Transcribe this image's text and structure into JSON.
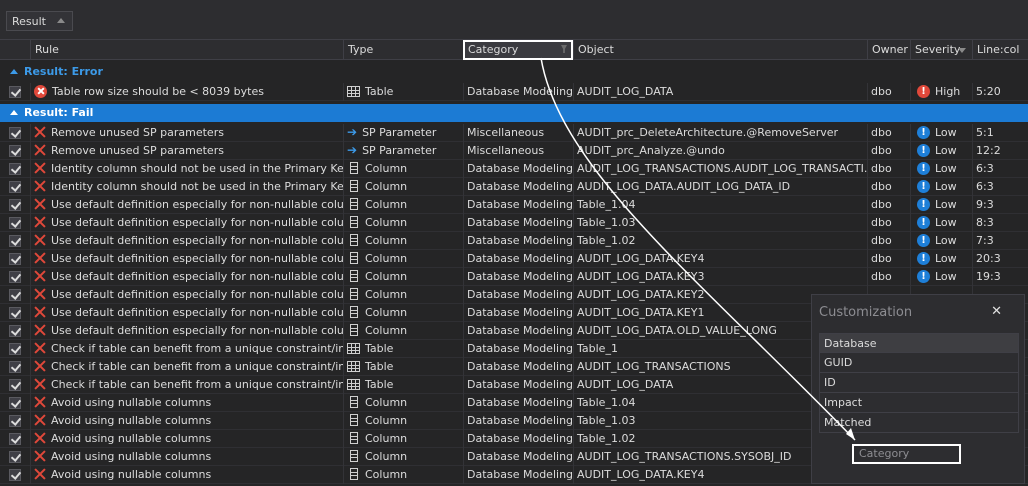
{
  "toolbar": {
    "group_label": "Result"
  },
  "columns": {
    "rule": "Rule",
    "type": "Type",
    "category": "Category",
    "object": "Object",
    "owner": "Owner",
    "severity": "Severity",
    "linecol": "Line:col"
  },
  "groups": {
    "error": "Result: Error",
    "fail": "Result: Fail"
  },
  "error_rows": [
    {
      "rule": "Table row size should be < 8039 bytes",
      "type": "Table",
      "category": "Database Modeling",
      "object": "AUDIT_LOG_DATA",
      "owner": "dbo",
      "severity": "High",
      "linecol": "5:20"
    }
  ],
  "fail_rows": [
    {
      "rule": "Remove unused SP parameters",
      "type": "SP Parameter",
      "category": "Miscellaneous",
      "object": "AUDIT_prc_DeleteArchitecture.@RemoveServer",
      "owner": "dbo",
      "severity": "Low",
      "linecol": "5:1"
    },
    {
      "rule": "Remove unused SP parameters",
      "type": "SP Parameter",
      "category": "Miscellaneous",
      "object": "AUDIT_prc_Analyze.@undo",
      "owner": "dbo",
      "severity": "Low",
      "linecol": "12:2"
    },
    {
      "rule": "Identity column should not be used in the Primary Key",
      "type": "Column",
      "category": "Database Modeling",
      "object": "AUDIT_LOG_TRANSACTIONS.AUDIT_LOG_TRANSACTI...",
      "owner": "dbo",
      "severity": "Low",
      "linecol": "6:3"
    },
    {
      "rule": "Identity column should not be used in the Primary Key",
      "type": "Column",
      "category": "Database Modeling",
      "object": "AUDIT_LOG_DATA.AUDIT_LOG_DATA_ID",
      "owner": "dbo",
      "severity": "Low",
      "linecol": "6:3"
    },
    {
      "rule": "Use default definition especially for non-nullable columns",
      "type": "Column",
      "category": "Database Modeling",
      "object": "Table_1.04",
      "owner": "dbo",
      "severity": "Low",
      "linecol": "9:3"
    },
    {
      "rule": "Use default definition especially for non-nullable columns",
      "type": "Column",
      "category": "Database Modeling",
      "object": "Table_1.03",
      "owner": "dbo",
      "severity": "Low",
      "linecol": "8:3"
    },
    {
      "rule": "Use default definition especially for non-nullable columns",
      "type": "Column",
      "category": "Database Modeling",
      "object": "Table_1.02",
      "owner": "dbo",
      "severity": "Low",
      "linecol": "7:3"
    },
    {
      "rule": "Use default definition especially for non-nullable columns",
      "type": "Column",
      "category": "Database Modeling",
      "object": "AUDIT_LOG_DATA.KEY4",
      "owner": "dbo",
      "severity": "Low",
      "linecol": "20:3"
    },
    {
      "rule": "Use default definition especially for non-nullable columns",
      "type": "Column",
      "category": "Database Modeling",
      "object": "AUDIT_LOG_DATA.KEY3",
      "owner": "dbo",
      "severity": "Low",
      "linecol": "19:3"
    },
    {
      "rule": "Use default definition especially for non-nullable columns",
      "type": "Column",
      "category": "Database Modeling",
      "object": "AUDIT_LOG_DATA.KEY2",
      "owner": "",
      "severity": "",
      "linecol": ""
    },
    {
      "rule": "Use default definition especially for non-nullable columns",
      "type": "Column",
      "category": "Database Modeling",
      "object": "AUDIT_LOG_DATA.KEY1",
      "owner": "",
      "severity": "",
      "linecol": ""
    },
    {
      "rule": "Use default definition especially for non-nullable columns",
      "type": "Column",
      "category": "Database Modeling",
      "object": "AUDIT_LOG_DATA.OLD_VALUE_LONG",
      "owner": "",
      "severity": "",
      "linecol": ""
    },
    {
      "rule": "Check if table can benefit from a unique constraint/index",
      "type": "Table",
      "category": "Database Modeling",
      "object": "Table_1",
      "owner": "",
      "severity": "",
      "linecol": ""
    },
    {
      "rule": "Check if table can benefit from a unique constraint/index",
      "type": "Table",
      "category": "Database Modeling",
      "object": "AUDIT_LOG_TRANSACTIONS",
      "owner": "",
      "severity": "",
      "linecol": ""
    },
    {
      "rule": "Check if table can benefit from a unique constraint/index",
      "type": "Table",
      "category": "Database Modeling",
      "object": "AUDIT_LOG_DATA",
      "owner": "",
      "severity": "",
      "linecol": ""
    },
    {
      "rule": "Avoid using nullable columns",
      "type": "Column",
      "category": "Database Modeling",
      "object": "Table_1.04",
      "owner": "",
      "severity": "",
      "linecol": ""
    },
    {
      "rule": "Avoid using nullable columns",
      "type": "Column",
      "category": "Database Modeling",
      "object": "Table_1.03",
      "owner": "",
      "severity": "",
      "linecol": ""
    },
    {
      "rule": "Avoid using nullable columns",
      "type": "Column",
      "category": "Database Modeling",
      "object": "Table_1.02",
      "owner": "",
      "severity": "",
      "linecol": ""
    },
    {
      "rule": "Avoid using nullable columns",
      "type": "Column",
      "category": "Database Modeling",
      "object": "AUDIT_LOG_TRANSACTIONS.SYSOBJ_ID",
      "owner": "",
      "severity": "",
      "linecol": ""
    },
    {
      "rule": "Avoid using nullable columns",
      "type": "Column",
      "category": "Database Modeling",
      "object": "AUDIT_LOG_DATA.KEY4",
      "owner": "",
      "severity": "",
      "linecol": ""
    }
  ],
  "customization": {
    "title": "Customization",
    "close": "✕",
    "items": [
      "Database",
      "GUID",
      "ID",
      "Impact",
      "Matched"
    ],
    "drop_label": "Category"
  },
  "icons": {
    "error": "error-circle-icon",
    "fail": "red-x-icon",
    "table": "table-icon",
    "column": "column-icon",
    "sp_parameter": "arrow-right-icon",
    "severity_low": "info-circle-icon",
    "severity_high": "warning-circle-icon"
  },
  "colors": {
    "accent": "#1c7bd4",
    "error": "#e0483a",
    "low": "#1e7fd8"
  }
}
